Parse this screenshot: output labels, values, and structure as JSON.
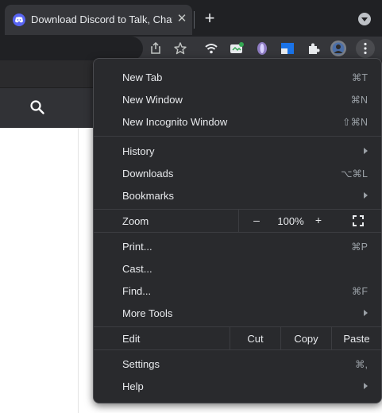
{
  "tab": {
    "title": "Download Discord to Talk, Chat, and Hang Out",
    "favicon": "discord-icon",
    "close_label": "✕"
  },
  "tabstrip": {
    "new_tab_label": "+"
  },
  "toolbar": {
    "icons": [
      "share-icon",
      "bookmark-star-icon",
      "wifi-extension-icon",
      "screenshot-extension-icon",
      "purple-gem-extension-icon",
      "blue-window-extension-icon",
      "extensions-puzzle-icon",
      "profile-avatar",
      "more-menu-icon"
    ]
  },
  "menu": {
    "new_tab": {
      "label": "New Tab",
      "accel": "⌘T"
    },
    "new_window": {
      "label": "New Window",
      "accel": "⌘N"
    },
    "new_incognito": {
      "label": "New Incognito Window",
      "accel": "⇧⌘N"
    },
    "history": {
      "label": "History"
    },
    "downloads": {
      "label": "Downloads",
      "accel": "⌥⌘L"
    },
    "bookmarks": {
      "label": "Bookmarks"
    },
    "zoom": {
      "label": "Zoom",
      "minus": "–",
      "level": "100%",
      "plus": "+"
    },
    "print": {
      "label": "Print...",
      "accel": "⌘P"
    },
    "cast": {
      "label": "Cast..."
    },
    "find": {
      "label": "Find...",
      "accel": "⌘F"
    },
    "more_tools": {
      "label": "More Tools"
    },
    "edit": {
      "label": "Edit",
      "cut": "Cut",
      "copy": "Copy",
      "paste": "Paste"
    },
    "settings": {
      "label": "Settings",
      "accel": "⌘,"
    },
    "help": {
      "label": "Help"
    }
  },
  "colors": {
    "menu_bg": "#292a2d",
    "tab_active": "#35363a",
    "tabstrip_bg": "#202124",
    "discord_blurple": "#5865f2"
  }
}
